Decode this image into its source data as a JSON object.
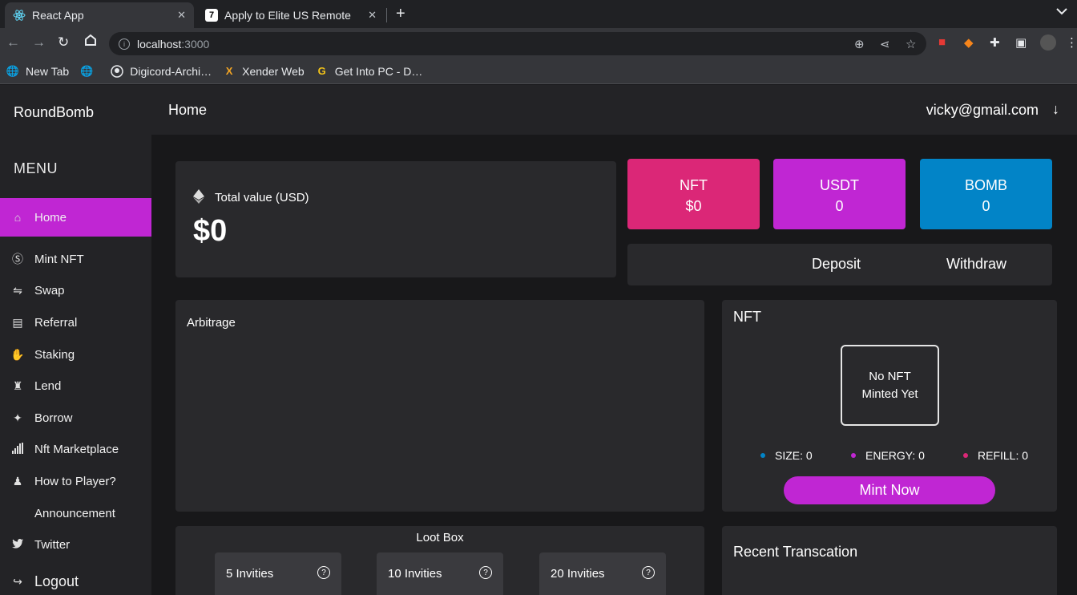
{
  "browser": {
    "tabs": [
      {
        "title": "React App",
        "icon": "react-icon"
      },
      {
        "title": "Apply to Elite US Remote",
        "icon": "turing-icon"
      }
    ],
    "url_host": "localhost",
    "url_port": ":3000",
    "bookmarks": [
      {
        "label": "New Tab",
        "icon": "globe-icon"
      },
      {
        "label": "",
        "icon": "globe-icon"
      },
      {
        "label": "Digicord-Archi…",
        "icon": "github-icon"
      },
      {
        "label": "Xender Web",
        "icon": "xender-icon"
      },
      {
        "label": "Get Into PC - D…",
        "icon": "g-icon"
      }
    ]
  },
  "app": {
    "brand": "RoundBomb",
    "menu_title": "MENU",
    "accent": "#c026d3",
    "menu": [
      {
        "label": "Home",
        "icon": "home-icon",
        "active": true
      },
      {
        "label": "Mint NFT",
        "icon": "coin-icon"
      },
      {
        "label": "Swap",
        "icon": "swap-icon"
      },
      {
        "label": "Referral",
        "icon": "referral-icon"
      },
      {
        "label": "Staking",
        "icon": "handshake-icon"
      },
      {
        "label": "Lend",
        "icon": "lend-icon"
      },
      {
        "label": "Borrow",
        "icon": "money-icon"
      },
      {
        "label": "Nft Marketplace",
        "icon": "signal-icon"
      },
      {
        "label": "How to Player?",
        "icon": "players-icon"
      },
      {
        "label": "Announcement",
        "icon": ""
      },
      {
        "label": "Twitter",
        "icon": "twitter-icon"
      },
      {
        "label": "Logout",
        "icon": "logout-icon"
      }
    ],
    "header": {
      "title": "Home",
      "email": "vicky@gmail.com"
    },
    "total": {
      "label": "Total value (USD)",
      "value": "$0"
    },
    "stats": [
      {
        "name": "NFT",
        "value": "$0",
        "color": "#db2777"
      },
      {
        "name": "USDT",
        "value": "0",
        "color": "#c026d3"
      },
      {
        "name": "BOMB",
        "value": "0",
        "color": "#0284c7"
      }
    ],
    "actions": {
      "deposit": "Deposit",
      "withdraw": "Withdraw"
    },
    "arbitrage": {
      "title": "Arbitrage"
    },
    "nft": {
      "title": "NFT",
      "empty_line1": "No NFT",
      "empty_line2": "Minted Yet",
      "stats": [
        {
          "label": "SIZE: 0",
          "color": "#0284c7"
        },
        {
          "label": "ENERGY: 0",
          "color": "#c026d3"
        },
        {
          "label": "REFILL: 0",
          "color": "#db2777"
        }
      ],
      "mint_label": "Mint Now"
    },
    "loot": {
      "title": "Loot Box",
      "invites": [
        "5 Invities",
        "10 Invities",
        "20 Invities"
      ]
    },
    "recent": {
      "title": "Recent Transcation"
    }
  }
}
